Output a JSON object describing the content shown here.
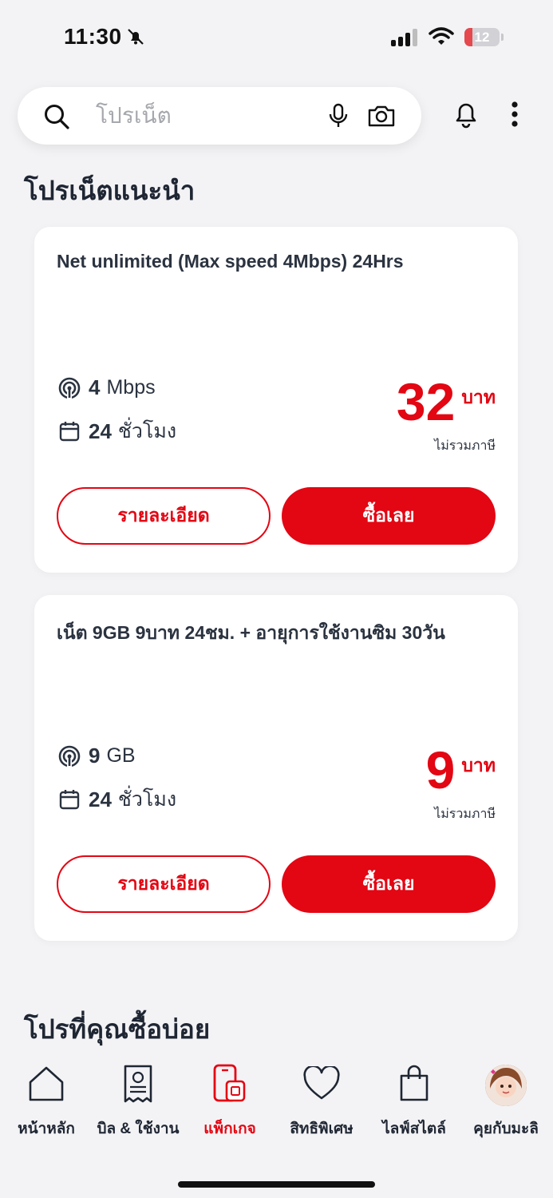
{
  "status_bar": {
    "time": "11:30",
    "battery": "12",
    "battery_level": 0.12
  },
  "search": {
    "placeholder": "โปรเน็ต"
  },
  "sections": {
    "recommended_title": "โปรเน็ตแนะนำ",
    "frequent_title": "โปรที่คุณซื้อบ่อย"
  },
  "cards": [
    {
      "title": "Net unlimited (Max speed 4Mbps) 24Hrs",
      "data_value": "4",
      "data_unit": "Mbps",
      "duration_value": "24",
      "duration_unit": "ชั่วโมง",
      "price": "32",
      "price_unit": "บาท",
      "price_note": "ไม่รวมภาษี",
      "details_label": "รายละเอียด",
      "buy_label": "ซื้อเลย"
    },
    {
      "title": "เน็ต 9GB 9บาท 24ชม. + อายุการใช้งานซิม 30วัน",
      "data_value": "9",
      "data_unit": "GB",
      "duration_value": "24",
      "duration_unit": "ชั่วโมง",
      "price": "9",
      "price_unit": "บาท",
      "price_note": "ไม่รวมภาษี",
      "details_label": "รายละเอียด",
      "buy_label": "ซื้อเลย"
    }
  ],
  "bottom_nav": [
    {
      "label": "หน้าหลัก",
      "icon": "home-icon"
    },
    {
      "label": "บิล & ใช้งาน",
      "icon": "bill-icon"
    },
    {
      "label": "แพ็กเกจ",
      "icon": "package-icon",
      "active": true
    },
    {
      "label": "สิทธิพิเศษ",
      "icon": "heart-icon"
    },
    {
      "label": "ไลฟ์สไตล์",
      "icon": "shopping-bag-icon"
    },
    {
      "label": "คุยกับมะลิ",
      "icon": "avatar"
    }
  ],
  "colors": {
    "accent": "#e30613",
    "background": "#f3f3f5",
    "card": "#ffffff",
    "text": "#1f2633"
  }
}
